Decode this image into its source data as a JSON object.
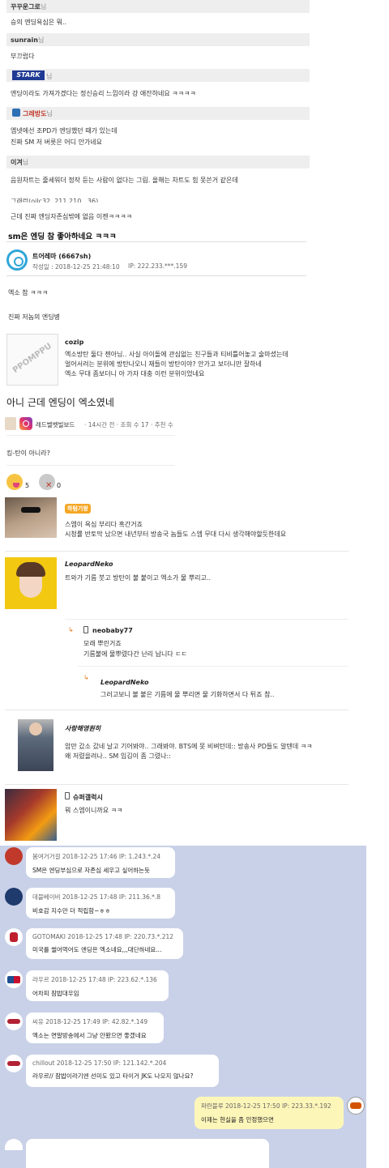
{
  "thread1": {
    "comments": [
      {
        "nick": "꾸꾸운그로",
        "suffix": "님",
        "text": "승의 엔딩욕심은 뭐.."
      },
      {
        "nick": "sunrain",
        "suffix": "님",
        "text": "부끄럽다"
      },
      {
        "nick": "STARK",
        "suffix": "님",
        "text": "엔딩이라도 가져가겠다는 정신승리 느낌이라 걍 애잔하네요 ㅋㅋㅋㅋ"
      },
      {
        "nick": "그레방도",
        "suffix": "님",
        "text_lines": [
          "엠넷에선 조PD가 엔딩했던 때가 있는데",
          "진짜 SM 저 버릇은 어디 안가네요"
        ]
      },
      {
        "nick": "이겨",
        "suffix": "님",
        "text": "음원차트는 줄세워더 정작 듣는 사람이 없다는 그림. 올해는 차트도 힘 못쓴거 같은데"
      }
    ],
    "partial_line": "그래런(ojlc32, 211.210.  .36)",
    "last_line": "근데 진짜 엔딩자존심밖에 없음 이젠ㅋㅋㅋㅋ"
  },
  "post2": {
    "title": "sm은 엔딩 참 좋아하네요 ㅋㅋㅋ",
    "author": "트어레마 (6667sh)",
    "date_label": "작성일 : 2018-12-25 21:48:10",
    "ip_label": "IP: 222.233.***.159",
    "line1": "엑소 참 ㅋㅋㅋ",
    "line2": "진짜 저놈의 엔딩병"
  },
  "ppomppu": {
    "logo_text": "PPOMPPU",
    "nick": "cozip",
    "lines": [
      "엑소방탄 둘다 젠아님.. 사실 아이돌에 관심없는 친구들과 티비틀어놓고 술마셨는데",
      "얼어서려는 분위에 방탄나오니 재들이 방탄이야? 안가고 보더니만 잘하네",
      "엑소 무대 좀보더니 아 가자 대충 이런 분위이었네요"
    ]
  },
  "post3": {
    "title": "아니 근데 엔딩이 엑소였네",
    "board": "레드벨벳빌보드",
    "meta": "· 14시간 전 · 조회 수 17 · 추천 수",
    "text": "킹-탄이 아니라?",
    "reaction1": "5",
    "reaction2": "0"
  },
  "post4": {
    "comments": [
      {
        "nick": "하텀기왕",
        "lines": [
          "스엠이 욕심 부리다 혹간거죠",
          "시청률 반토막 났으면 내년부터 방송국 놈들도 스엠 무대 다시 생각해야할듯한데요"
        ]
      },
      {
        "nick": "LeopardNeko",
        "lines": [
          "트와가 기름 붓고 방탄이 불 붙이고 엑소가 물 뿌리고.."
        ]
      },
      {
        "nick": "neobaby77",
        "lines": [
          "모래 뿌린거죠",
          "기름불에 물뿌렸다간 난리 납니다 ㄷㄷ"
        ]
      },
      {
        "nick": "LeopardNeko",
        "lines": [
          "그러고보니 불 붙은 기름에 물 뿌리면 물 기화하면서 다 튀죠 참.."
        ]
      },
      {
        "nick": "사랑해영원히",
        "lines": [
          "암만 갔소 갔네 날고 기어봐야.. 그래봐야. BTS에 못 비벼턴데:: 방송사 PD들도 알텐데 ㅋㅋ",
          "왜 저렸을려나.. SM 입김이 좀 그렸나::"
        ]
      },
      {
        "nick": "슈퍼갤럭시",
        "lines": [
          "뭐 스엠이니까요 ㅋㅋ"
        ]
      }
    ]
  },
  "chat": {
    "messages": [
      {
        "nick": "봄여거거걸",
        "meta": "2018-12-25 17:46 IP: 1.243.*.24",
        "text": "SM은 엔딩부심으로 자존심 세우고 싶어하는듯",
        "color": "#c0392b"
      },
      {
        "nick": "데블베이비",
        "meta": "2018-12-25 17:48 IP: 211.36.*.8",
        "text": "비호감 지수만 더 적립함~ㅎㅎ",
        "color": "#1f3a6d"
      },
      {
        "nick": "GOTOMAKI",
        "meta": "2018-12-25 17:48 IP: 220.73.*.212",
        "text": "미국를 썰어먹어도 엔딩은 엑소네요,,,대단하네요...",
        "color": "#bf1e2e"
      },
      {
        "nick": "라우르",
        "meta": "2018-12-25 17:48 IP: 223.62.*.136",
        "text": "어차피 잠밥대우임",
        "color": "#1d4f91"
      },
      {
        "nick": "씨유",
        "meta": "2018-12-25 17:49 IP: 42.82.*.149",
        "text": "엑소는 연말방송에서 그냥 안봤으면 좋겠네요",
        "color": "#b22234"
      },
      {
        "nick": "chillout",
        "meta": "2018-12-25 17:50 IP: 121.142.*.204",
        "text": "라우르// 잠밥이라기엔 선미도 있고 타이거 JK도 나오지 않나요?",
        "color": "#b22234"
      }
    ],
    "mine": {
      "nick": "파란블루",
      "meta": "2018-12-25 17:50 IP: 223.33.*.192",
      "text": "이제는 현실을 좀 인정했으면"
    }
  }
}
